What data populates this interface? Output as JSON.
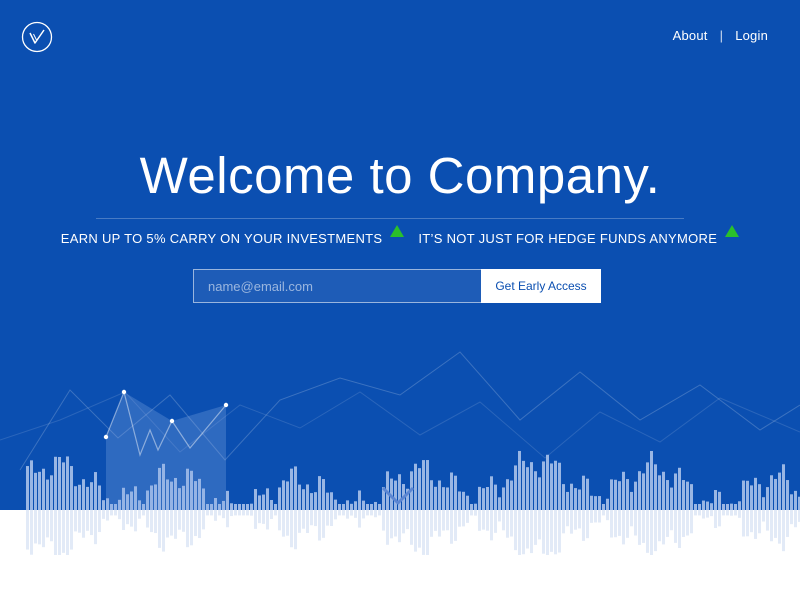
{
  "brand": {
    "logo_icon": "checkmark-circle-logo"
  },
  "nav": {
    "about_label": "About",
    "separator": "|",
    "login_label": "Login"
  },
  "hero": {
    "title": "Welcome to Company.",
    "taglines": [
      {
        "text": "EARN UP TO 5% CARRY ON YOUR INVESTMENTS",
        "icon": "up-triangle-icon"
      },
      {
        "text": "IT’S NOT JUST FOR HEDGE FUNDS ANYMORE",
        "icon": "up-triangle-icon"
      }
    ]
  },
  "signup": {
    "email_placeholder": "name@email.com",
    "email_value": "",
    "button_label": "Get Early Access"
  },
  "colors": {
    "background": "#0b4fb1",
    "accent_green": "#2ac02a",
    "bars": "#a9c1ea",
    "text": "#ffffff"
  },
  "decor": {
    "scroll_icon": "chevron-down-icon"
  }
}
